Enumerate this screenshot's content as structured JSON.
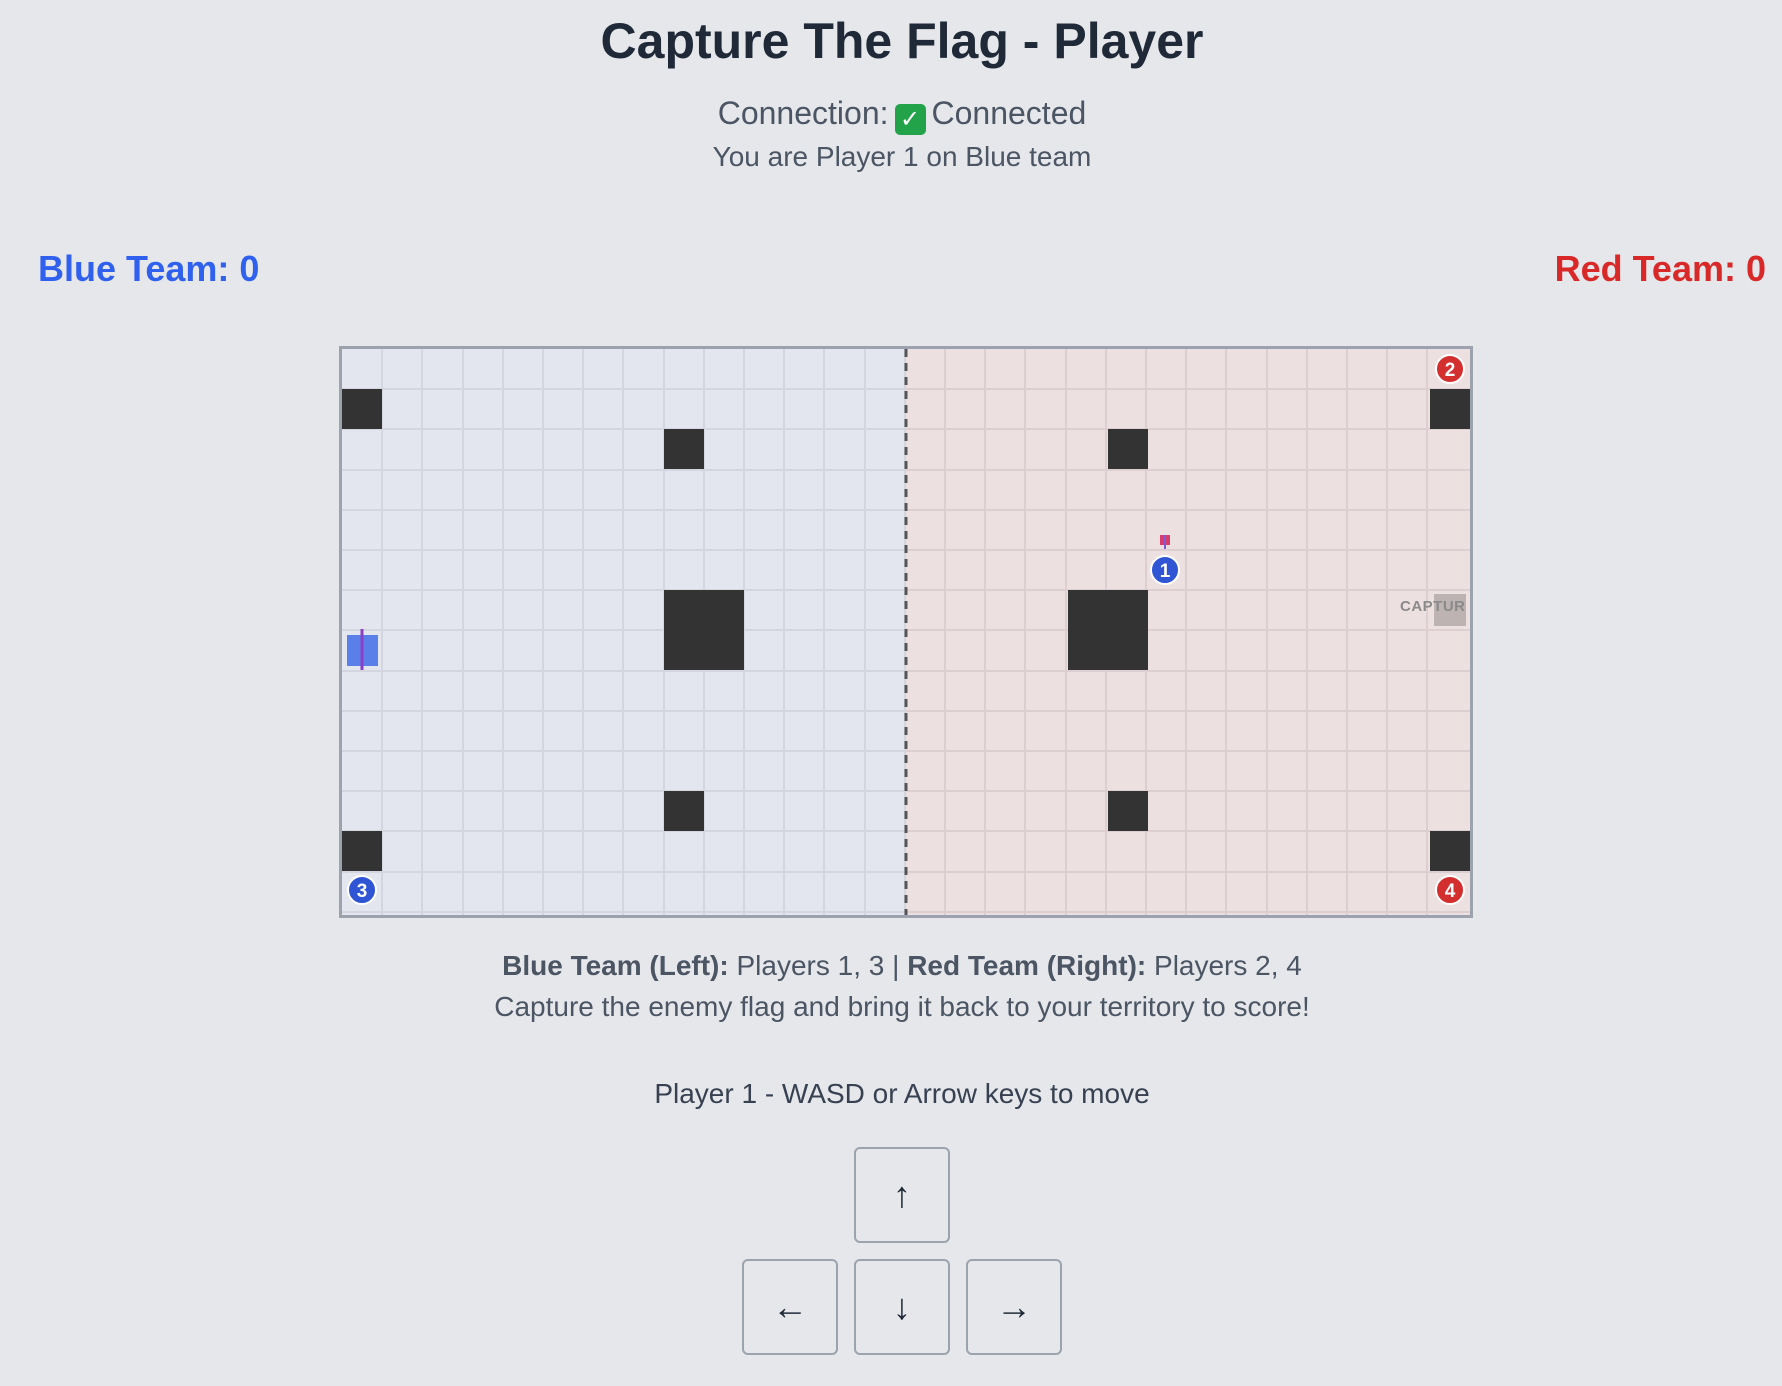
{
  "header": {
    "title": "Capture The Flag - Player",
    "connection_label": "Connection:",
    "connection_status": "Connected",
    "player_info": "You are Player 1 on Blue team"
  },
  "scores": {
    "blue": "Blue Team: 0",
    "red": "Red Team: 0"
  },
  "board": {
    "capture_label": "CAPTUR",
    "players": [
      {
        "number": "1",
        "team": "blue"
      },
      {
        "number": "2",
        "team": "red"
      },
      {
        "number": "3",
        "team": "blue"
      },
      {
        "number": "4",
        "team": "red"
      }
    ],
    "colors": {
      "blue_territory": "#e3e6ee",
      "red_territory": "#ede0e1",
      "obstacle": "#333333",
      "blue": "#2f55d4",
      "red": "#d32f2f"
    }
  },
  "info": {
    "blue_team_label": "Blue Team (Left):",
    "blue_team_players": "Players 1, 3",
    "separator": "|",
    "red_team_label": "Red Team (Right):",
    "red_team_players": "Players 2, 4",
    "objective": "Capture the enemy flag and bring it back to your territory to score!"
  },
  "controls": {
    "hint": "Player 1 - WASD or Arrow keys to move",
    "up": "↑",
    "left": "←",
    "down": "↓",
    "right": "→"
  }
}
